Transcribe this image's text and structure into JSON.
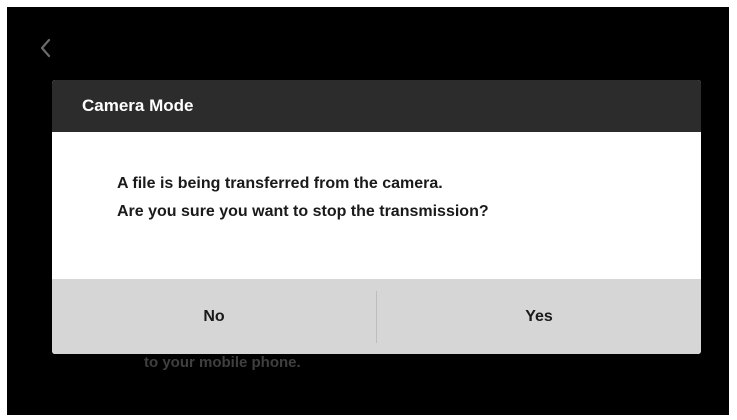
{
  "background": {
    "text": "to your mobile phone."
  },
  "dialog": {
    "title": "Camera Mode",
    "message_line1": "A file is being transferred from the camera.",
    "message_line2": "Are you sure you want to stop the transmission?",
    "no_label": "No",
    "yes_label": "Yes"
  },
  "icons": {
    "back": "chevron-left-icon"
  },
  "colors": {
    "screen_bg": "#000000",
    "header_bg": "#2c2c2c",
    "body_bg": "#ffffff",
    "buttons_bg": "#d6d6d6"
  }
}
